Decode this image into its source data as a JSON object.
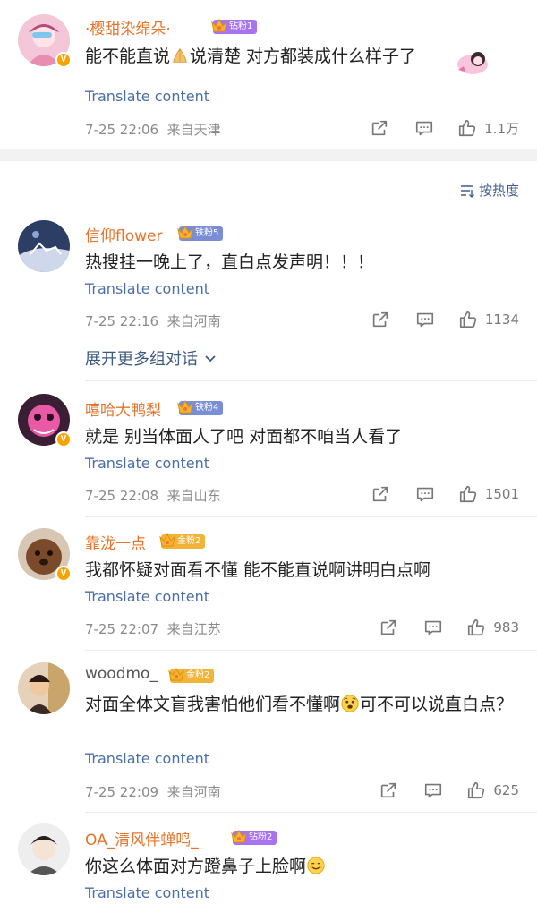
{
  "sort_label": "按热度",
  "expand_label": "展开更多组对话",
  "translate_label": "Translate content",
  "comments": [
    {
      "name": "·樱甜染绵朵·",
      "fan_badge": "钻粉1",
      "text_a": "能不能直说",
      "text_b": "说清楚 对方都装成什么样子了",
      "time": "7-25 22:06",
      "location": "来自天津",
      "likes": "1.1万"
    },
    {
      "name": "信仰flower",
      "fan_badge": "铁粉5",
      "text": "热搜挂一晚上了，直白点发声明！！！",
      "time": "7-25 22:16",
      "location": "来自河南",
      "likes": "1134"
    },
    {
      "name": "嘻哈大鸭梨",
      "fan_badge": "铁粉4",
      "text": "就是 别当体面人了吧 对面都不咱当人看了",
      "time": "7-25 22:08",
      "location": "来自山东",
      "likes": "1501"
    },
    {
      "name": "靠泷一点",
      "fan_badge": "金粉2",
      "text": "我都怀疑对面看不懂 能不能直说啊讲明白点啊",
      "time": "7-25 22:07",
      "location": "来自江苏",
      "likes": "983"
    },
    {
      "name": "woodmo_",
      "fan_badge": "金粉2",
      "text_a": "对面全体文盲我害怕他们看不懂啊",
      "text_b": "可不可以说直白点？",
      "time": "7-25 22:09",
      "location": "来自河南",
      "likes": "625"
    },
    {
      "name": "OA_清风伴蝉鸣_",
      "fan_badge": "钻粉2",
      "text": "你这么体面对方蹬鼻子上脸啊",
      "time": "",
      "location": "",
      "likes": ""
    }
  ],
  "colors": {
    "username": "#e6742b",
    "translate": "#4a6fa8",
    "link": "#3d5a85",
    "band": "#f2f2f2"
  },
  "icons": [
    "share-icon",
    "comment-icon",
    "like-icon",
    "sort-icon",
    "chevron-down-icon",
    "crown-icon",
    "verified-v-icon"
  ]
}
